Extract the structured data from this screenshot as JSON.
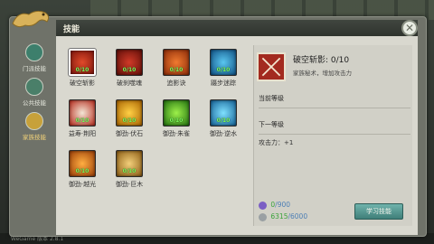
{
  "window": {
    "title": "技能"
  },
  "bottom_bar": {
    "text": "WeGame 版本 2.8.1"
  },
  "sidebar": {
    "items": [
      {
        "label": "门派技能",
        "icon": "sect-skill-icon",
        "color": "#3d7f6c"
      },
      {
        "label": "公共技能",
        "icon": "common-skill-icon",
        "color": "#4a7f69"
      },
      {
        "label": "家族技能",
        "icon": "family-skill-icon",
        "color": "#c7a13a",
        "active": true
      }
    ]
  },
  "skills": [
    {
      "name": "破空斩影",
      "level": "0/10",
      "icon": "crossed-swords-icon",
      "color": "#b32a20",
      "selected": true
    },
    {
      "name": "破刹噬魂",
      "level": "0/10",
      "icon": "skull-slash-icon",
      "color": "#a02318"
    },
    {
      "name": "追影诀",
      "level": "0/10",
      "icon": "shadow-chase-icon",
      "color": "#c84a17"
    },
    {
      "name": "蹑步迷踪",
      "level": "0/10",
      "icon": "mist-step-icon",
      "color": "#1e7fb9"
    },
    {
      "name": "益寿·荆阳",
      "level": "0/10",
      "icon": "longevity-icon",
      "color": "#c1321e"
    },
    {
      "name": "御劲·伏石",
      "level": "0/10",
      "icon": "stone-guard-icon",
      "color": "#d98e12"
    },
    {
      "name": "御劲·朱雀",
      "level": "0/10",
      "icon": "vermilion-bird-icon",
      "color": "#3e9e1f"
    },
    {
      "name": "御劲·逆水",
      "level": "0/10",
      "icon": "reverse-water-icon",
      "color": "#2a86b8"
    },
    {
      "name": "御劲·越光",
      "level": "0/10",
      "icon": "over-light-icon",
      "color": "#d46a12"
    },
    {
      "name": "御劲·巨木",
      "level": "0/10",
      "icon": "giant-wood-icon",
      "color": "#b98a2a"
    }
  ],
  "detail": {
    "name": "破空斩影: 0/10",
    "description": "家族秘术，增加攻击力",
    "current_level_label": "当前等级",
    "next_level_label": "下一等级",
    "attribute": "攻击力：+1"
  },
  "resources": {
    "contribution": {
      "current": "0",
      "max": "/900",
      "icon": "contribution-icon",
      "color": "#7b5fc4"
    },
    "silver": {
      "current": "6315",
      "max": "/6000",
      "icon": "silver-icon",
      "color": "#9aa0a3"
    }
  },
  "learn_button": {
    "label": "学习技能"
  }
}
